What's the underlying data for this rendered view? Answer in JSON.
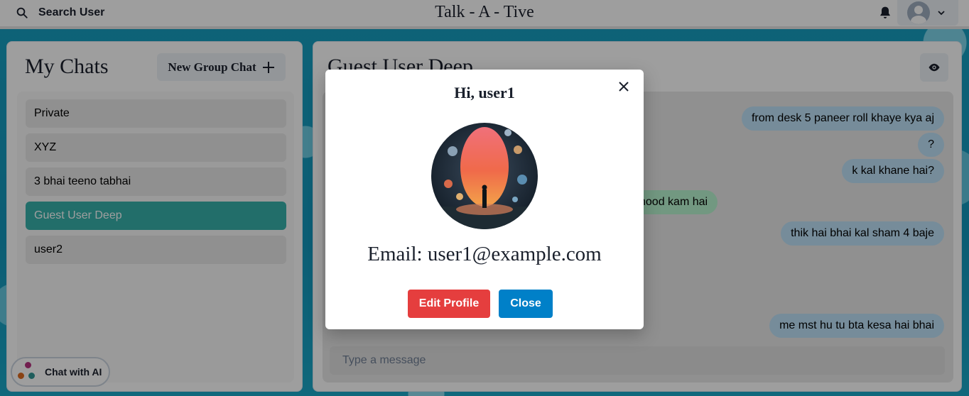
{
  "header": {
    "search_label": "Search User",
    "app_title": "Talk - A - Tive"
  },
  "sidebar": {
    "title": "My Chats",
    "new_group_label": "New Group Chat",
    "chats": [
      {
        "label": "Private",
        "active": false
      },
      {
        "label": "XYZ",
        "active": false
      },
      {
        "label": "3 bhai teeno tabhai",
        "active": false
      },
      {
        "label": "Guest User Deep",
        "active": true
      },
      {
        "label": "user2",
        "active": false
      }
    ],
    "ai_button_label": "Chat with AI"
  },
  "chat": {
    "title": "Guest User Deep",
    "messages": [
      {
        "text": "from desk 5 paneer roll khaye kya aj",
        "type": "sent"
      },
      {
        "text": "?",
        "type": "sent"
      },
      {
        "text": "k kal khane hai?",
        "type": "sent"
      },
      {
        "text": "hood kam hai",
        "type": "received"
      },
      {
        "text": "thik hai bhai kal sham 4 baje",
        "type": "sent"
      },
      {
        "text": "me mst hu tu bta kesa hai bhai",
        "type": "sent"
      }
    ],
    "input_placeholder": "Type a message"
  },
  "modal": {
    "title": "Hi, user1",
    "email": "Email: user1@example.com",
    "edit_label": "Edit Profile",
    "close_label": "Close"
  },
  "colors": {
    "active_chat": "#38b2ac",
    "sent_bubble": "#bee3f8",
    "received_bubble": "#b9f5d0",
    "edit_button": "#e53e3e",
    "close_button": "#0080c8"
  }
}
